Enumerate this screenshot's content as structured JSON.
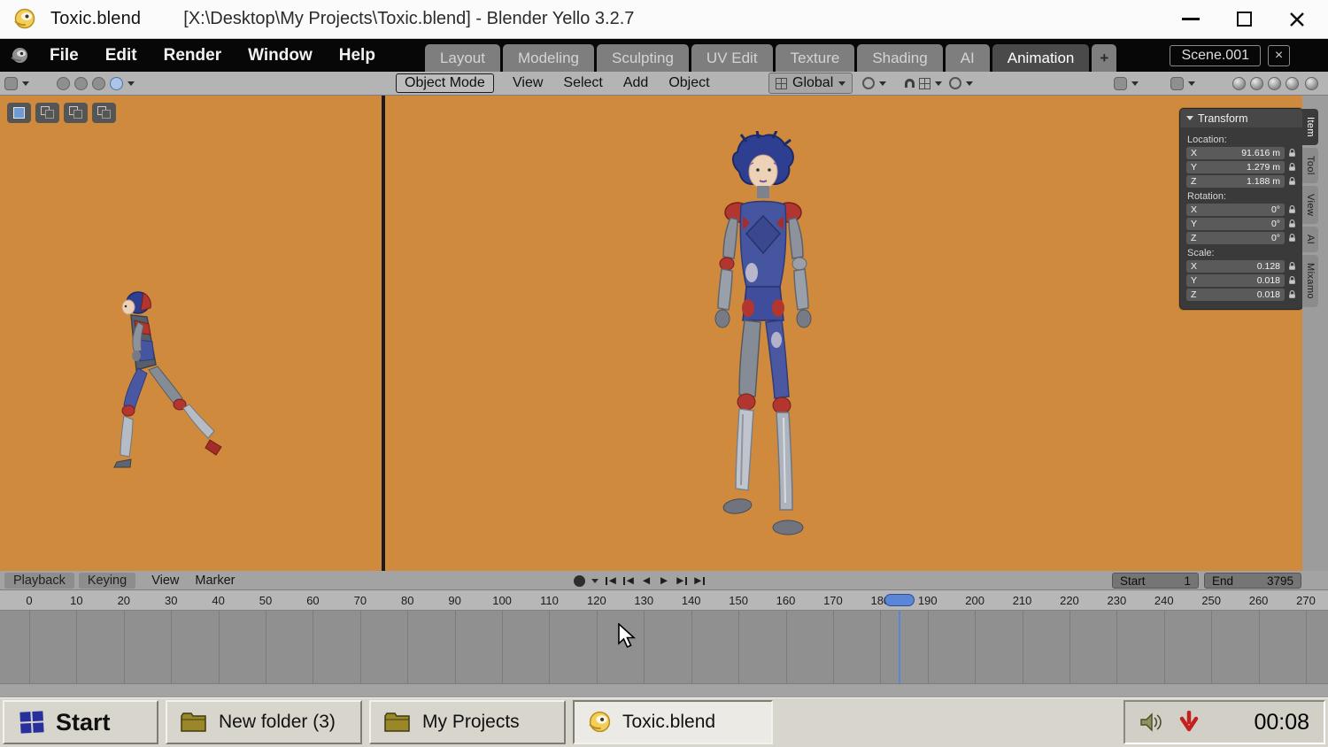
{
  "colors": {
    "viewport_bg": "#cf8a3e",
    "menubar_bg": "#070707",
    "panel_bg": "#3a3a3a",
    "active_tab_bg": "#4a4a4a",
    "playhead_blue": "#5b86d7",
    "taskbar_bg": "#d8d5cd"
  },
  "window": {
    "doc_title": "Toxic.blend",
    "full_title": "[X:\\Desktop\\My Projects\\Toxic.blend] - Blender Yello 3.2.7"
  },
  "menubar": {
    "menus": [
      "File",
      "Edit",
      "Render",
      "Window",
      "Help"
    ],
    "workspace_tabs": [
      "Layout",
      "Modeling",
      "Sculpting",
      "UV Edit",
      "Texture",
      "Shading",
      "AI",
      "Animation"
    ],
    "active_workspace": "Animation",
    "add_tab": "+",
    "scene_name": "Scene.001",
    "scene_close": "×"
  },
  "toolbar": {
    "mode": "Object Mode",
    "menus": [
      "View",
      "Select",
      "Add",
      "Object"
    ],
    "orientation": "Global"
  },
  "transform_panel": {
    "title": "Transform",
    "location_label": "Location:",
    "rotation_label": "Rotation:",
    "scale_label": "Scale:",
    "location": [
      {
        "axis": "X",
        "value": "91.616 m"
      },
      {
        "axis": "Y",
        "value": "1.279 m"
      },
      {
        "axis": "Z",
        "value": "1.188 m"
      }
    ],
    "rotation": [
      {
        "axis": "X",
        "value": "0°"
      },
      {
        "axis": "Y",
        "value": "0°"
      },
      {
        "axis": "Z",
        "value": "0°"
      }
    ],
    "scale": [
      {
        "axis": "X",
        "value": "0.128"
      },
      {
        "axis": "Y",
        "value": "0.018"
      },
      {
        "axis": "Z",
        "value": "0.018"
      }
    ],
    "side_tabs": [
      "Item",
      "Tool",
      "View",
      "AI",
      "Mixamo"
    ],
    "active_side_tab": "Item"
  },
  "timeline": {
    "menus": [
      "Playback",
      "Keying",
      "View",
      "Marker"
    ],
    "transport": [
      {
        "name": "jump-to-start",
        "glyph": "◀"
      },
      {
        "name": "previous-keyframe",
        "glyph": "◀"
      },
      {
        "name": "play-reverse",
        "glyph": "◀"
      },
      {
        "name": "play",
        "glyph": "▶"
      },
      {
        "name": "next-keyframe",
        "glyph": "▶"
      },
      {
        "name": "jump-to-end",
        "glyph": "▶"
      }
    ],
    "start_label": "Start",
    "start_value": "1",
    "end_label": "End",
    "end_value": "3795",
    "current_frame": 184,
    "ticks": [
      "0",
      "10",
      "20",
      "30",
      "40",
      "50",
      "60",
      "70",
      "80",
      "90",
      "100",
      "110",
      "120",
      "130",
      "140",
      "150",
      "160",
      "170",
      "180",
      "190",
      "200",
      "210",
      "220",
      "230",
      "240",
      "250",
      "260",
      "270"
    ]
  },
  "taskbar": {
    "start_label": "Start",
    "tasks": [
      {
        "label": "New folder (3)"
      },
      {
        "label": "My Projects"
      },
      {
        "label": "Toxic.blend"
      }
    ],
    "clock": "00:08"
  }
}
